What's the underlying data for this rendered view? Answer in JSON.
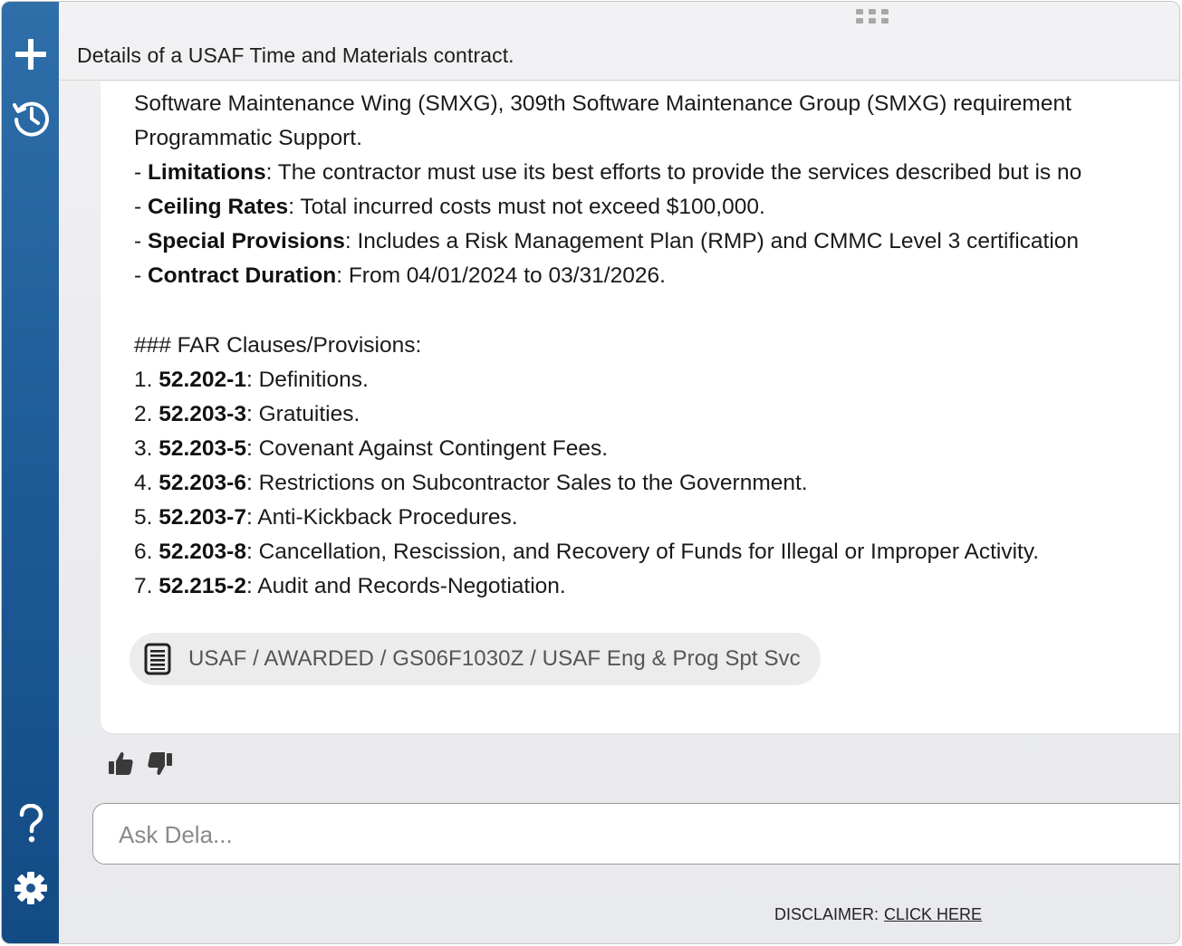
{
  "sidebar": {
    "new_chat_icon": "plus-icon",
    "history_icon": "history-icon",
    "help_icon": "question-mark-icon",
    "settings_icon": "gear-icon",
    "colors": {
      "top": "#2f6fa9",
      "bottom": "#134b84"
    }
  },
  "header": {
    "title": "Details of a USAF Time and Materials contract."
  },
  "response": {
    "lines": [
      {
        "prefix": "",
        "bold": "",
        "text": "Software Maintenance Wing (SMXG), 309th Software Maintenance Group (SMXG) requirement"
      },
      {
        "prefix": "",
        "bold": "",
        "text": "Programmatic Support."
      },
      {
        "prefix": "- ",
        "bold": "Limitations",
        "text": ": The contractor must use its best efforts to provide the services described but is no"
      },
      {
        "prefix": "- ",
        "bold": "Ceiling Rates",
        "text": ": Total incurred costs must not exceed $100,000."
      },
      {
        "prefix": "- ",
        "bold": "Special Provisions",
        "text": ": Includes a Risk Management Plan (RMP) and CMMC Level 3 certification"
      },
      {
        "prefix": "- ",
        "bold": "Contract Duration",
        "text": ": From 04/01/2024 to 03/31/2026."
      }
    ],
    "far_heading": "### FAR Clauses/Provisions:",
    "far_items": [
      {
        "prefix": "1. ",
        "bold": "52.202-1",
        "text": ": Definitions."
      },
      {
        "prefix": "2. ",
        "bold": "52.203-3",
        "text": ": Gratuities."
      },
      {
        "prefix": "3. ",
        "bold": "52.203-5",
        "text": ": Covenant Against Contingent Fees."
      },
      {
        "prefix": "4. ",
        "bold": "52.203-6",
        "text": ": Restrictions on Subcontractor Sales to the Government."
      },
      {
        "prefix": "5. ",
        "bold": "52.203-7",
        "text": ": Anti-Kickback Procedures."
      },
      {
        "prefix": "6. ",
        "bold": "52.203-8",
        "text": ": Cancellation, Rescission, and Recovery of Funds for Illegal or Improper Activity."
      },
      {
        "prefix": "7. ",
        "bold": "52.215-2",
        "text": ": Audit and Records-Negotiation."
      }
    ],
    "source": {
      "icon": "document-icon",
      "label": "USAF / AWARDED / GS06F1030Z / USAF Eng & Prog Spt Svc"
    }
  },
  "feedback": {
    "thumbs_up_icon": "thumbs-up-icon",
    "thumbs_down_icon": "thumbs-down-icon"
  },
  "composer": {
    "placeholder": "Ask Dela...",
    "value": ""
  },
  "footer": {
    "disclaimer_label": "DISCLAIMER:",
    "disclaimer_link": "CLICK HERE"
  }
}
